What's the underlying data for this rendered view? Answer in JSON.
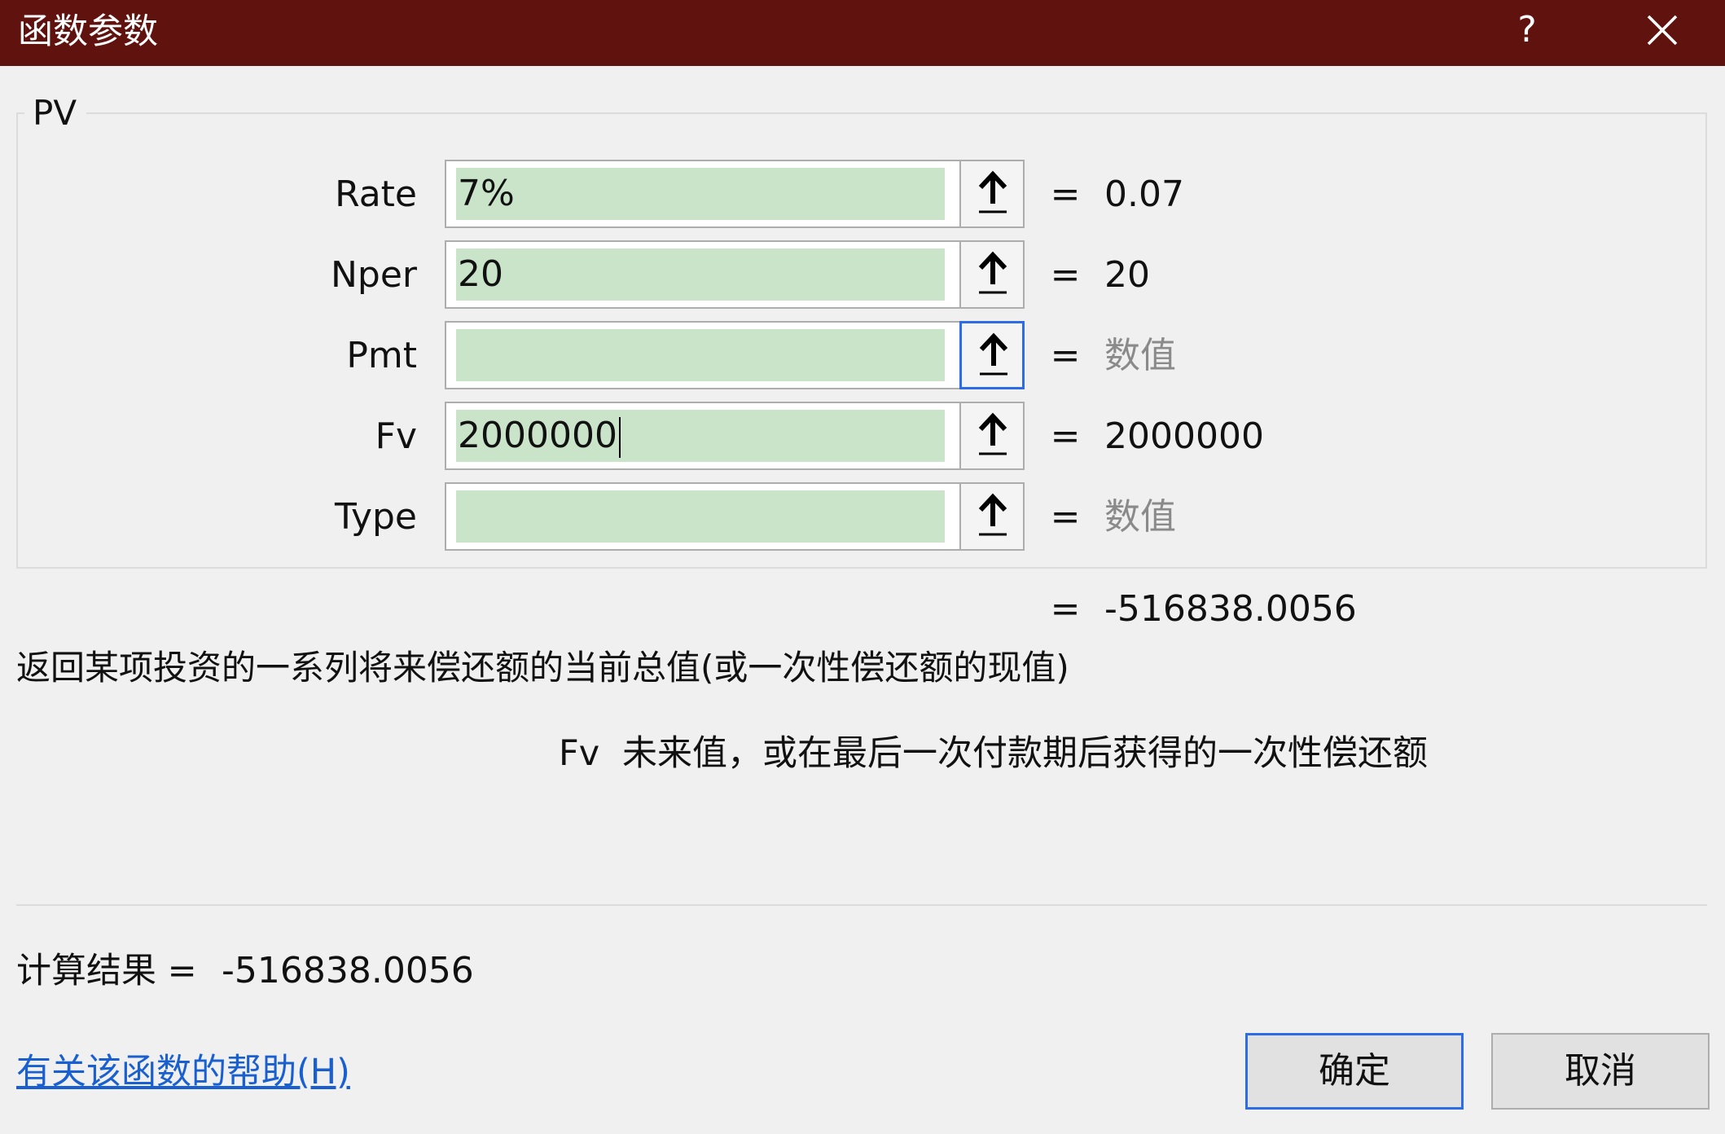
{
  "window": {
    "title": "函数参数",
    "help_glyph": "?",
    "title_bar_color": "#60130e"
  },
  "function_name": "PV",
  "arguments": [
    {
      "name": "Rate",
      "input": "7%",
      "equals": "=",
      "value": "0.07",
      "placeholder": false
    },
    {
      "name": "Nper",
      "input": "20",
      "equals": "=",
      "value": "20",
      "placeholder": false
    },
    {
      "name": "Pmt",
      "input": "",
      "equals": "=",
      "value": "数值",
      "placeholder": true
    },
    {
      "name": "Fv",
      "input": "2000000",
      "equals": "=",
      "value": "2000000",
      "placeholder": false
    },
    {
      "name": "Type",
      "input": "",
      "equals": "=",
      "value": "数值",
      "placeholder": true
    }
  ],
  "result_preview": {
    "equals": "=",
    "value": "-516838.0056"
  },
  "description": "返回某项投资的一系列将来偿还额的当前总值(或一次性偿还额的现值)",
  "parameter_help": {
    "name": "Fv",
    "text": "未来值，或在最后一次付款期后获得的一次性偿还额"
  },
  "calculation": {
    "label": "计算结果 =",
    "value": "-516838.0056"
  },
  "help_link": "有关该函数的帮助(H)",
  "buttons": {
    "ok": "确定",
    "cancel": "取消"
  },
  "colors": {
    "input_fill": "#c9e4c8",
    "focus_border": "#2e6be6",
    "link": "#1a5fd0"
  },
  "icons": {
    "ref_button": "collapse-dialog-arrow-up-icon",
    "close": "close-icon"
  }
}
